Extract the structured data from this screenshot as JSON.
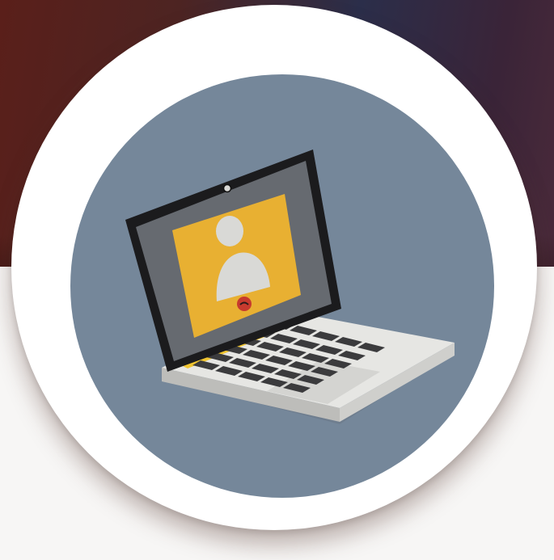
{
  "illustration": {
    "subject": "laptop-video-call",
    "icons": [
      "laptop-icon",
      "user-avatar-icon",
      "end-call-icon",
      "webcam-icon"
    ]
  },
  "colors": {
    "background_top": "#4d2422",
    "background_top_mid": "#2b2e4a",
    "background_bottom": "#f7f6f5",
    "outer_circle": "#ffffff",
    "inner_circle": "#75879a",
    "screen_frame": "#1b1b1d",
    "screen": "#666a70",
    "call_window": "#e8b032",
    "avatar": "#d9d9d6",
    "end_call_button": "#c73a2e",
    "keyboard_base": "#e6e6e3",
    "keys": "#3b3b3d",
    "hinge_accent": "#f0c531"
  }
}
